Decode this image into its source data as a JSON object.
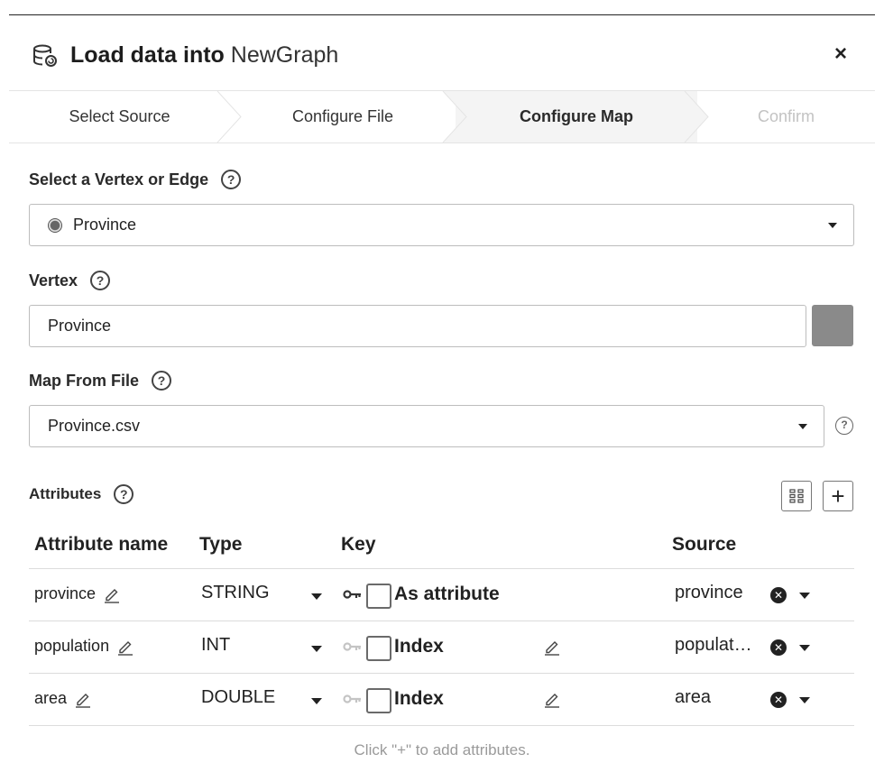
{
  "header": {
    "title_bold": "Load data into",
    "title_graph": "NewGraph",
    "icon": "database-icon",
    "close_label": "×"
  },
  "steps": [
    {
      "label": "Select Source"
    },
    {
      "label": "Configure File"
    },
    {
      "label": "Configure Map",
      "active": true
    },
    {
      "label": "Confirm",
      "disabled": true
    }
  ],
  "vertex_edge_select": {
    "label": "Select a Vertex or Edge",
    "help": "?",
    "value": "Province"
  },
  "vertex": {
    "label": "Vertex",
    "help": "?",
    "value": "Province",
    "color": "#8a8a8a"
  },
  "map_file": {
    "label": "Map From File",
    "help": "?",
    "value": "Province.csv",
    "side_help": "?"
  },
  "attributes": {
    "label": "Attributes",
    "help": "?",
    "add_label": "+",
    "columns": {
      "name": "Attribute name",
      "type": "Type",
      "key": "Key",
      "source": "Source"
    },
    "rows": [
      {
        "name": "province",
        "type": "STRING",
        "key_label": "As attribute",
        "primary_key": true,
        "source": "province"
      },
      {
        "name": "population",
        "type": "INT",
        "key_label": "Index",
        "primary_key": false,
        "source": "populat…"
      },
      {
        "name": "area",
        "type": "DOUBLE",
        "key_label": "Index",
        "primary_key": false,
        "source": "area"
      }
    ],
    "hint": "Click \"+\" to add attributes."
  },
  "colors": {
    "active_step_bg": "#f4f4f4",
    "disabled_step": "#c3c3c3",
    "swatch": "#8a8a8a"
  }
}
